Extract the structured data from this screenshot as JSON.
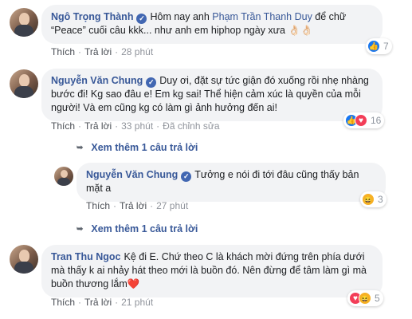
{
  "comments": [
    {
      "author": "Ngô Trọng Thành",
      "text_before": "Hôm nay anh ",
      "mention": "Phạm Trần Thanh Duy",
      "text_after": " để chữ “Peace” cuối câu kkk... như anh em hiphop ngày xưa 👌🏻👌🏻",
      "actions": {
        "like": "Thích",
        "reply": "Trả lời",
        "time": "28 phút"
      },
      "reactions": {
        "icons": [
          "like-icon"
        ],
        "count": "7"
      }
    },
    {
      "author": "Nguyễn Văn Chung",
      "text": "Duy ơi, đặt sự tức giận đó xuống rồi nhẹ nhàng bước đi! Kg sao đâu e! Em kg sai! Thể hiện cảm xúc là quyền của mỗi người! Và em cũng kg có làm gì ảnh hưởng đến ai!",
      "actions": {
        "like": "Thích",
        "reply": "Trả lời",
        "time": "33 phút",
        "edited": "Đã chỉnh sửa"
      },
      "reactions": {
        "icons": [
          "like-icon",
          "love-icon"
        ],
        "count": "16"
      },
      "more_replies": "Xem thêm 1 câu trả lời"
    },
    {
      "author": "Nguyễn Văn Chung",
      "text": "Tưởng e nói đi tới đâu cũng thấy bản mặt a",
      "actions": {
        "like": "Thích",
        "reply": "Trả lời",
        "time": "27 phút"
      },
      "reactions": {
        "icons": [
          "haha-icon"
        ],
        "count": "3"
      },
      "more_replies": "Xem thêm 1 câu trả lời"
    },
    {
      "author": "Tran Thu Ngoc",
      "text": "Kệ đi E. Chứ theo C là khách mời đứng trên phía dưới mà thấy k ai nhảy hát theo mới là buồn đó. Nên đừng để tâm làm gì mà buồn thương lắm❤️",
      "actions": {
        "like": "Thích",
        "reply": "Trả lời",
        "time": "21 phút"
      },
      "reactions": {
        "icons": [
          "love-icon"
        ],
        "count": "5"
      }
    }
  ],
  "colors": {
    "author": "#385898",
    "bubble": "#f2f3f5",
    "like": "#1877f2",
    "love": "#f33e58",
    "haha": "#f7b125"
  }
}
